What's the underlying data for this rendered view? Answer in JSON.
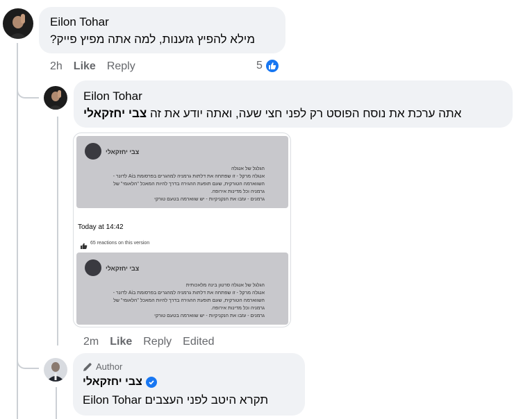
{
  "comment1": {
    "author": "Eilon Tohar",
    "text": "מילא להפיץ גזענות, למה אתה מפיץ פייק?",
    "time": "2h",
    "like_label": "Like",
    "reply_label": "Reply",
    "reactions_count": "5"
  },
  "reply1": {
    "author": "Eilon Tohar",
    "text_plain": "אתה ערכת את נוסח הפוסט רק לפני חצי שעה, ואתה יודע את זה",
    "mention": "צבי יחזקאלי",
    "time": "2m",
    "like_label": "Like",
    "reply_label": "Reply",
    "edited_label": "Edited",
    "image": {
      "post1": {
        "author": "צבי יחזקאלי",
        "lines": [
          "הגלגל של אנגלה",
          "אנגלה מרקל - זו שפתחה את דלתות גרמניה למהגרים בפרסומת בAi לדונר -",
          "השווארמה הטורקית, שעם תופעת ההגירה בדרך להיות המאכל \"הלאומי\" של",
          "גרמניה וכל מדינות אירופה.",
          "גרמנים - עזבו את הנקניקיות - יש שווארמה בטעם טורקי"
        ]
      },
      "timestamp": "Today at 14:42",
      "reactions": "65 reactions on this version",
      "post2": {
        "author": "צבי יחזקאלי",
        "lines": [
          "הגלגל של אנגלה סרטון בינה מלאכותית",
          "אנגלה מרקל - זו שפתחה את דלתות גרמניה למהגרים בפרסומת בAi לדונר -",
          "השווארמה הטורקית, שעם תופעת ההגירה בדרך להיות המאכל \"הלאומי\" של",
          "גרמניה וכל מדינות אירופה.",
          "גרמנים - עזבו את הנקניקיות - יש שווארמה בטעם טורקי"
        ]
      }
    }
  },
  "reply2": {
    "badge": "Author",
    "author": "צבי יחזקאלי",
    "text": "תקרא היטב לפני העצבים",
    "mention": "Eilon Tohar"
  },
  "colors": {
    "bubble": "#f0f2f5",
    "muted": "#65676b",
    "accent": "#1877f2"
  }
}
